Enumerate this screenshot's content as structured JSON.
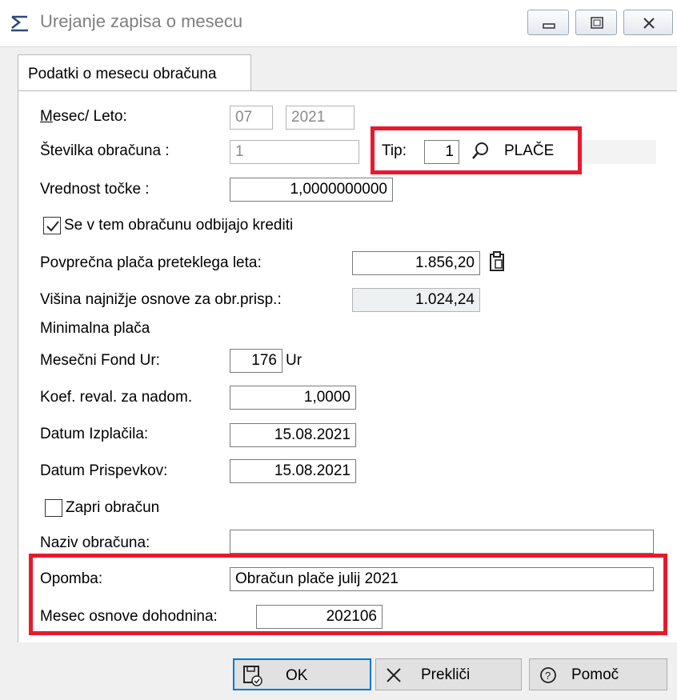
{
  "window": {
    "title": "Urejanje zapisa o mesecu"
  },
  "tab": {
    "label": "Podatki o mesecu obračuna"
  },
  "form": {
    "mesec_leto_label": "Mesec/ Leto:",
    "month_value": "07",
    "year_value": "2021",
    "stevilka_label": "Številka obračuna :",
    "stevilka_value": "1",
    "tip_label": "Tip:",
    "tip_value": "1",
    "tip_name": "PLAČE",
    "vrednost_label": "Vrednost točke :",
    "vrednost_value": "1,0000000000",
    "krediti_label": "Se v tem obračunu odbijajo krediti",
    "krediti_checked": true,
    "povprecna_label": "Povprečna plača preteklega leta:",
    "povprecna_value": "1.856,20",
    "visina_label": "Višina najnižje osnove za obr.prisp.:",
    "visina_value": "1.024,24",
    "minimalna_label": "Minimalna plača",
    "fond_label": "Mesečni Fond Ur:",
    "fond_value": "176",
    "fond_unit": "Ur",
    "koef_label": "Koef. reval. za nadom.",
    "koef_value": "1,0000",
    "izplacila_label": "Datum Izplačila:",
    "izplacila_value": "15.08.2021",
    "prispevkov_label": "Datum Prispevkov:",
    "prispevkov_value": "15.08.2021",
    "zapri_label": "Zapri obračun",
    "zapri_checked": false,
    "naziv_label": "Naziv obračuna:",
    "naziv_value": "",
    "opomba_label": "Opomba:",
    "opomba_value": "Obračun plače julij 2021",
    "mesec_osnove_label": "Mesec osnove dohodnina:",
    "mesec_osnove_value": "202106"
  },
  "buttons": {
    "ok": "OK",
    "cancel": "Prekliči",
    "help": "Pomoč"
  },
  "colors": {
    "highlight": "#e8192c",
    "default_button_border": "#0078d7"
  }
}
